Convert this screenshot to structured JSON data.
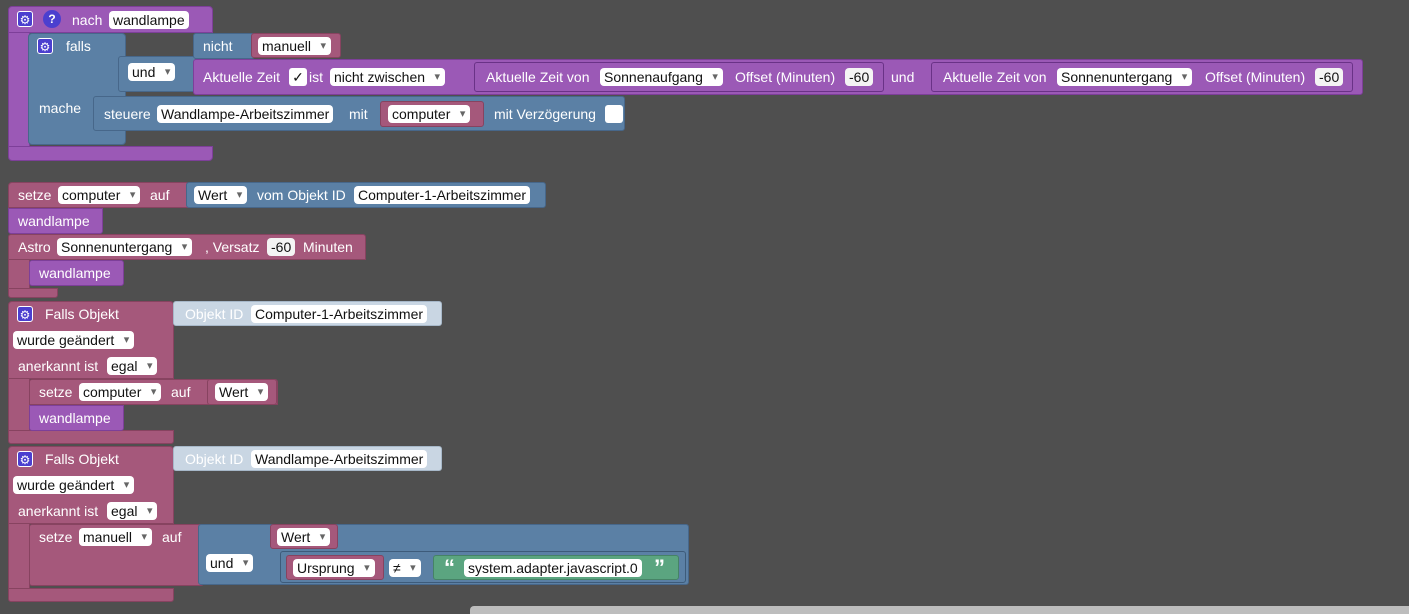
{
  "func": {
    "label": "nach",
    "name": "wandlampe",
    "if_label": "falls",
    "not_label": "nicht",
    "manuell": "manuell",
    "und1": "und",
    "current_time": "Aktuelle Zeit",
    "checkmark": "✓",
    "ist": "ist",
    "between": "nicht zwischen",
    "time_of": "Aktuelle Zeit von",
    "sunrise": "Sonnenaufgang",
    "offset": "Offset (Minuten)",
    "offset_val1": "-60",
    "und2": "und",
    "sunset": "Sonnenuntergang",
    "offset_val2": "-60",
    "do_label": "mache",
    "control": "steuere",
    "device": "Wandlampe-Arbeitszimmer",
    "with": "mit",
    "computer_var": "computer",
    "delay": "mit Verzögerung"
  },
  "set1": {
    "label": "setze",
    "var": "computer",
    "to": "auf",
    "value": "Wert",
    "from_obj": "vom Objekt ID",
    "obj_id": "Computer-1-Arbeitszimmer"
  },
  "call1": {
    "name": "wandlampe"
  },
  "astro": {
    "label": "Astro",
    "event": "Sonnenuntergang",
    "offset": ", Versatz",
    "offset_val": "-60",
    "unit": "Minuten",
    "call": "wandlampe"
  },
  "trigger1": {
    "label": "Falls Objekt",
    "obj_label": "Objekt ID",
    "obj_id": "Computer-1-Arbeitszimmer",
    "changed": "wurde geändert",
    "ack_label": "anerkannt ist",
    "ack_val": "egal",
    "set_label": "setze",
    "set_var": "computer",
    "to": "auf",
    "value": "Wert",
    "call": "wandlampe"
  },
  "trigger2": {
    "label": "Falls Objekt",
    "obj_label": "Objekt ID",
    "obj_id": "Wandlampe-Arbeitszimmer",
    "changed": "wurde geändert",
    "ack_label": "anerkannt ist",
    "ack_val": "egal",
    "set_label": "setze",
    "set_var": "manuell",
    "to": "auf",
    "value": "Wert",
    "und": "und",
    "origin": "Ursprung",
    "neq": "≠",
    "quote_open": "“",
    "string": "system.adapter.javascript.0",
    "quote_close": "”"
  }
}
